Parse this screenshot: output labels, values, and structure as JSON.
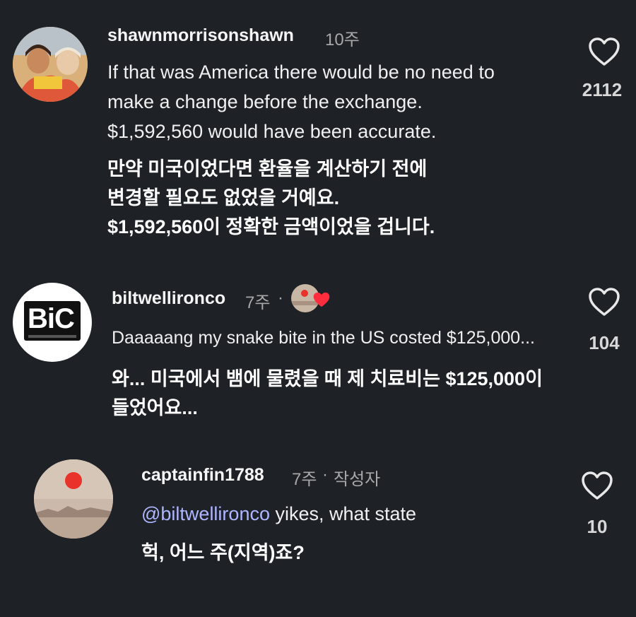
{
  "comments": [
    {
      "username": "shawnmorrisonshawn",
      "time": "10주",
      "text_lines": [
        "If that was America there would be no need to",
        "make a change before the exchange.",
        "$1,592,560 would have been accurate."
      ],
      "translation_lines": [
        "만약 미국이었다면 환율을 계산하기 전에",
        "변경할 필요도 없었을 거예요.",
        "$1,592,560이 정확한 금액이었을 겁니다."
      ],
      "likes": "2112"
    },
    {
      "username": "biltwellironco",
      "time": "7주",
      "separator": "·",
      "avatar_logo": "BiC",
      "text_lines": [
        "Daaaaang my snake bite in the US costed $125,000..."
      ],
      "translation_lines": [
        "와... 미국에서 뱀에 물렸을 때 제 치료비는 $125,000이",
        "들었어요..."
      ],
      "likes": "104"
    },
    {
      "username": "captainfin1788",
      "time": "7주",
      "separator": "·",
      "author_badge": "작성자",
      "mention": "@biltwellironco",
      "text_rest": " yikes, what state",
      "translation_lines": [
        "헉, 어느 주(지역)죠?"
      ],
      "likes": "10"
    }
  ],
  "colors": {
    "background": "#1e2126",
    "mention": "#aeb6ff",
    "heart_outline": "#e8e8e8",
    "liked_heart": "#ff2d3d"
  },
  "icons": {
    "like": "heart-outline-icon",
    "liked_by_author": "red-heart-icon"
  }
}
